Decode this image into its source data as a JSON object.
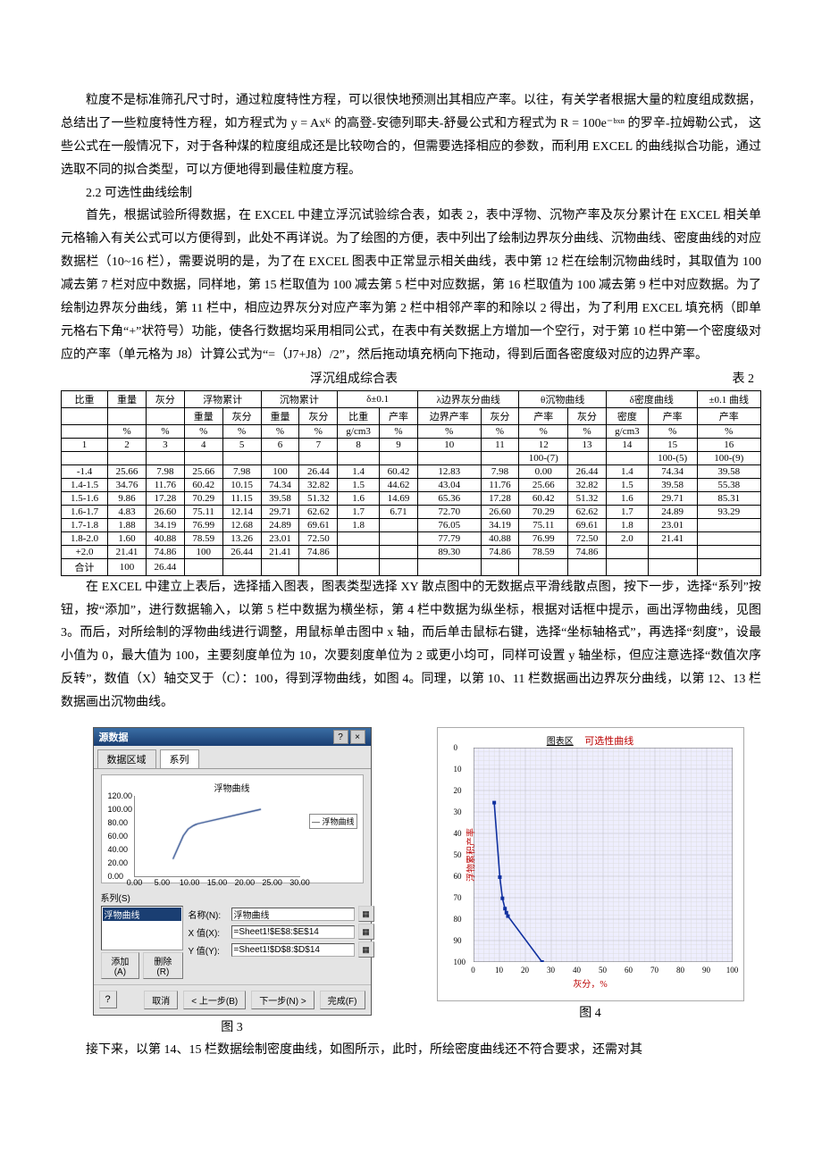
{
  "paragraphs": {
    "p1": "粒度不是标准筛孔尺寸时，通过粒度特性方程，可以很快地预测出其相应产率。以往，有关学者根据大量的粒度组成数据，总结出了一些粒度特性方程，如方程式为 y = Axᴷ 的高登-安德列耶夫-舒曼公式和方程式为 R = 100e⁻ᵇˣⁿ 的罗辛-拉姆勒公式， 这些公式在一般情况下，对于各种煤的粒度组成还是比较吻合的，但需要选择相应的参数，而利用 EXCEL 的曲线拟合功能，通过选取不同的拟合类型，可以方便地得到最佳粒度方程。",
    "sect22": "2.2 可选性曲线绘制",
    "p2": "首先，根据试验所得数据，在 EXCEL 中建立浮沉试验综合表，如表 2，表中浮物、沉物产率及灰分累计在 EXCEL 相关单元格输入有关公式可以方便得到，此处不再详说。为了绘图的方便，表中列出了绘制边界灰分曲线、沉物曲线、密度曲线的对应数据栏（10~16 栏），需要说明的是，为了在 EXCEL 图表中正常显示相关曲线，表中第 12 栏在绘制沉物曲线时，其取值为 100 减去第 7 栏对应中数据，同样地，第 15 栏取值为 100 减去第 5 栏中对应数据，第 16 栏取值为 100 减去第 9 栏中对应数据。为了绘制边界灰分曲线，第 11 栏中，相应边界灰分对应产率为第 2 栏中相邻产率的和除以 2 得出，为了利用 EXCEL 填充柄（即单元格右下角“+”状符号）功能，使各行数据均采用相同公式，在表中有关数据上方增加一个空行，对于第 10 栏中第一个密度级对应的产率（单元格为 J8）计算公式为“=（J7+J8）/2”，然后拖动填充柄向下拖动，得到后面各密度级对应的边界产率。",
    "p3": "在 EXCEL 中建立上表后，选择插入图表，图表类型选择 XY 散点图中的无数据点平滑线散点图，按下一步，选择“系列”按钮，按“添加”，进行数据输入，以第 5 栏中数据为横坐标，第 4 栏中数据为纵坐标，根据对话框中提示，画出浮物曲线，见图 3。而后，对所绘制的浮物曲线进行调整，用鼠标单击图中 x 轴，而后单击鼠标右键，选择“坐标轴格式”，再选择“刻度”，设最小值为 0，最大值为 100，主要刻度单位为 10，次要刻度单位为 2 或更小均可，同样可设置 y 轴坐标，但应注意选择“数值次序反转”，数值（X）轴交叉于（C）：100，得到浮物曲线，如图 4。同理，以第 10、11 栏数据画出边界灰分曲线，以第 12、13 栏数据画出沉物曲线。",
    "p4": "接下来，以第 14、15 栏数据绘制密度曲线，如图所示，此时，所绘密度曲线还不符合要求，还需对其"
  },
  "table_title_center": "浮沉组成综合表",
  "table_title_right": "表 2",
  "table": {
    "head1": [
      "比重",
      "重量",
      "灰分",
      "浮物累计",
      "",
      "沉物累计",
      "",
      "δ±0.1",
      "",
      "λ边界灰分曲线",
      "",
      "θ沉物曲线",
      "",
      "δ密度曲线",
      "",
      "±0.1 曲线"
    ],
    "head2": [
      "",
      "",
      "",
      "重量",
      "灰分",
      "重量",
      "灰分",
      "比重",
      "产率",
      "边界产率",
      "灰分",
      "产率",
      "灰分",
      "密度",
      "产率",
      "产率"
    ],
    "head3": [
      "",
      "%",
      "%",
      "%",
      "%",
      "%",
      "%",
      "g/cm3",
      "%",
      "%",
      "%",
      "%",
      "%",
      "g/cm3",
      "%",
      "%"
    ],
    "head4": [
      "1",
      "2",
      "3",
      "4",
      "5",
      "6",
      "7",
      "8",
      "9",
      "10",
      "11",
      "12",
      "13",
      "14",
      "15",
      "16"
    ],
    "head5": [
      "",
      "",
      "",
      "",
      "",
      "",
      "",
      "",
      "",
      "",
      "",
      "100-(7)",
      "",
      "",
      "100-(5)",
      "100-(9)"
    ],
    "rows": [
      [
        "-1.4",
        "25.66",
        "7.98",
        "25.66",
        "7.98",
        "100",
        "26.44",
        "1.4",
        "60.42",
        "12.83",
        "7.98",
        "0.00",
        "26.44",
        "1.4",
        "74.34",
        "39.58"
      ],
      [
        "1.4-1.5",
        "34.76",
        "11.76",
        "60.42",
        "10.15",
        "74.34",
        "32.82",
        "1.5",
        "44.62",
        "43.04",
        "11.76",
        "25.66",
        "32.82",
        "1.5",
        "39.58",
        "55.38"
      ],
      [
        "1.5-1.6",
        "9.86",
        "17.28",
        "70.29",
        "11.15",
        "39.58",
        "51.32",
        "1.6",
        "14.69",
        "65.36",
        "17.28",
        "60.42",
        "51.32",
        "1.6",
        "29.71",
        "85.31"
      ],
      [
        "1.6-1.7",
        "4.83",
        "26.60",
        "75.11",
        "12.14",
        "29.71",
        "62.62",
        "1.7",
        "6.71",
        "72.70",
        "26.60",
        "70.29",
        "62.62",
        "1.7",
        "24.89",
        "93.29"
      ],
      [
        "1.7-1.8",
        "1.88",
        "34.19",
        "76.99",
        "12.68",
        "24.89",
        "69.61",
        "1.8",
        "",
        "76.05",
        "34.19",
        "75.11",
        "69.61",
        "1.8",
        "23.01",
        ""
      ],
      [
        "1.8-2.0",
        "1.60",
        "40.88",
        "78.59",
        "13.26",
        "23.01",
        "72.50",
        "",
        "",
        "77.79",
        "40.88",
        "76.99",
        "72.50",
        "2.0",
        "21.41",
        ""
      ],
      [
        "+2.0",
        "21.41",
        "74.86",
        "100",
        "26.44",
        "21.41",
        "74.86",
        "",
        "",
        "89.30",
        "74.86",
        "78.59",
        "74.86",
        "",
        "",
        ""
      ],
      [
        "合计",
        "100",
        "26.44",
        "",
        "",
        "",
        "",
        "",
        "",
        "",
        "",
        "",
        "",
        "",
        "",
        ""
      ]
    ]
  },
  "fig3": {
    "dlg_title": "源数据",
    "tab1": "数据区域",
    "tab2": "系列",
    "mini_title": "浮物曲线",
    "legend": "浮物曲线",
    "series_label": "系列(S)",
    "series_sel": "浮物曲线",
    "name_label": "名称(N):",
    "name_val": "浮物曲线",
    "x_label": "X 值(X):",
    "x_val": "=Sheet1!$E$8:$E$14",
    "y_label": "Y 值(Y):",
    "y_val": "=Sheet1!$D$8:$D$14",
    "add": "添加(A)",
    "del": "删除(R)",
    "cancel": "取消",
    "back": "< 上一步(B)",
    "next": "下一步(N) >",
    "finish": "完成(F)",
    "cap": "图 3",
    "y_ticks": [
      "120.00",
      "100.00",
      "80.00",
      "60.00",
      "40.00",
      "20.00",
      "0.00"
    ],
    "x_ticks": [
      "0.00",
      "5.00",
      "10.00",
      "15.00",
      "20.00",
      "25.00",
      "30.00"
    ]
  },
  "fig4": {
    "top_label": "图表区",
    "title": "可选性曲线",
    "y_label": "浮物累积产率",
    "x_label": "灰分，%",
    "cap": "图 4"
  },
  "chart_data": {
    "type": "line",
    "title": "可选性曲线",
    "xlabel": "灰分，%",
    "ylabel": "浮物累积产率",
    "xlim": [
      0,
      100
    ],
    "ylim_reversed": [
      0,
      100
    ],
    "x_major": 10,
    "y_major": 10,
    "series": [
      {
        "name": "浮物曲线",
        "x": [
          7.98,
          10.15,
          11.15,
          12.14,
          12.68,
          13.26,
          26.44
        ],
        "y": [
          25.66,
          60.42,
          70.29,
          75.11,
          76.99,
          78.59,
          100
        ]
      }
    ]
  }
}
